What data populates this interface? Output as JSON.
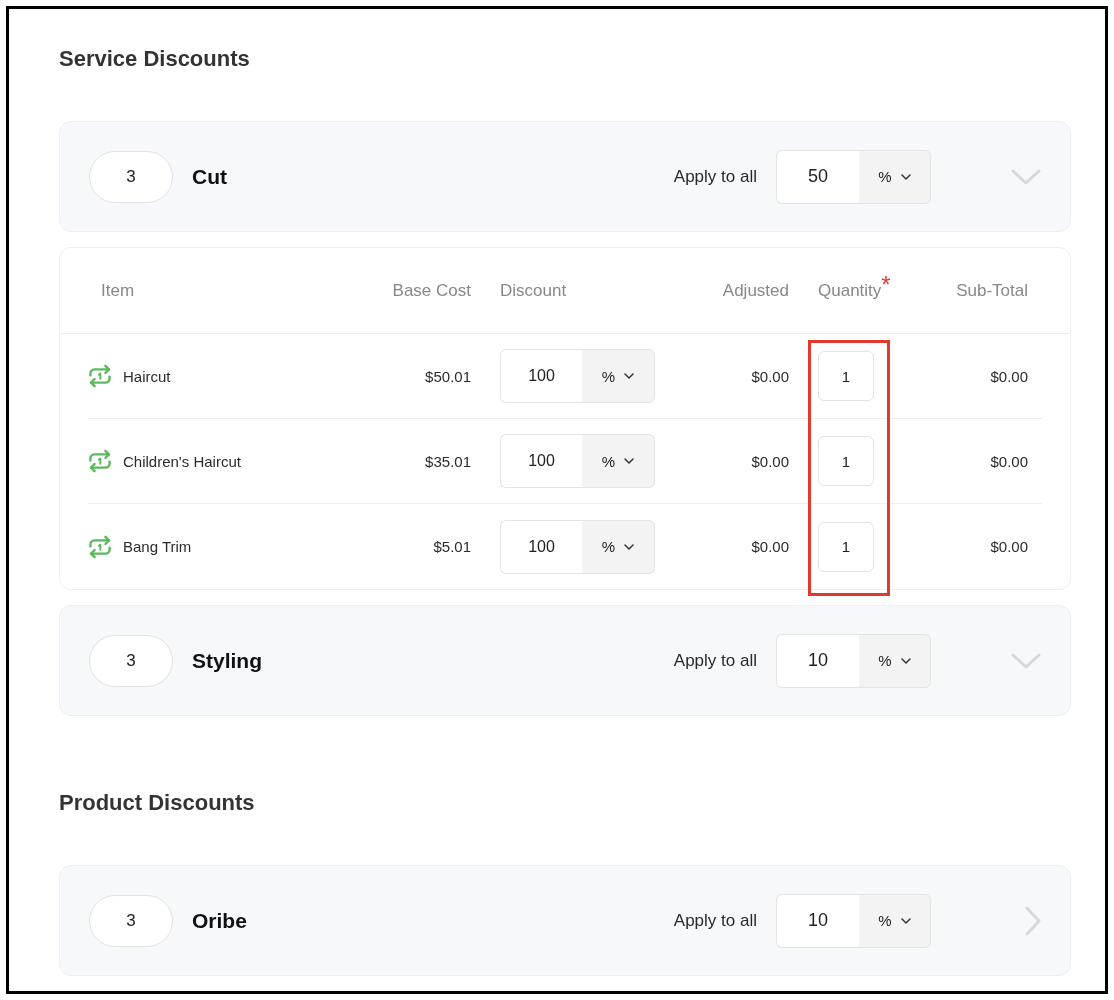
{
  "sections": [
    {
      "title": "Service Discounts",
      "groups": [
        {
          "count": "3",
          "name": "Cut",
          "apply_label": "Apply to all",
          "apply_value": "50",
          "apply_unit": "%",
          "kind": "dropdown",
          "table": {
            "columns": [
              {
                "label": "Item",
                "highlighted": false
              },
              {
                "label": "Base Cost",
                "highlighted": false
              },
              {
                "label": "Discount",
                "highlighted": false
              },
              {
                "label": "Adjusted",
                "highlighted": false
              },
              {
                "label": "Quantity",
                "mark": "*",
                "highlighted": true
              },
              {
                "label": "Sub-Total",
                "highlighted": false
              }
            ],
            "rows": [
              {
                "item": "Haircut",
                "base_cost": "$50.01",
                "discount": "100",
                "discount_unit": "%",
                "adjusted": "$0.00",
                "quantity": "1",
                "subtotal": "$0.00"
              },
              {
                "item": "Children's Haircut",
                "base_cost": "$35.01",
                "discount": "100",
                "discount_unit": "%",
                "adjusted": "$0.00",
                "quantity": "1",
                "subtotal": "$0.00"
              },
              {
                "item": "Bang Trim",
                "base_cost": "$5.01",
                "discount": "100",
                "discount_unit": "%",
                "adjusted": "$0.00",
                "quantity": "1",
                "subtotal": "$0.00"
              }
            ]
          }
        },
        {
          "count": "3",
          "name": "Styling",
          "apply_label": "Apply to all",
          "apply_value": "10",
          "apply_unit": "%",
          "kind": "dropdown"
        }
      ]
    },
    {
      "title": "Product Discounts",
      "groups": [
        {
          "count": "3",
          "name": "Oribe",
          "apply_label": "Apply to all",
          "apply_value": "10",
          "apply_unit": "%",
          "kind": "link"
        }
      ]
    }
  ]
}
